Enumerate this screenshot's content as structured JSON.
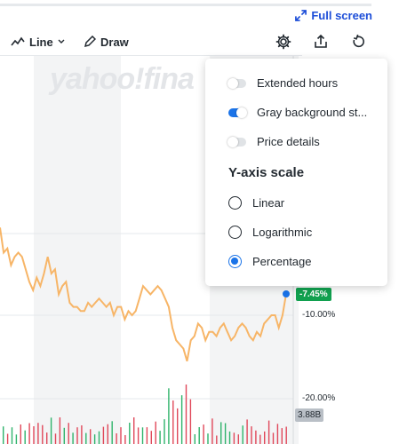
{
  "header": {
    "fullscreen_label": "Full screen",
    "fullscreen_icon": "expand-arrows-icon"
  },
  "toolbar": {
    "line_label": "Line",
    "line_icon": "line-chart-icon",
    "draw_label": "Draw",
    "draw_icon": "pencil-icon",
    "settings_icon": "gear-icon",
    "share_icon": "share-icon",
    "reset_icon": "reset-icon"
  },
  "watermark": "yahoo!fina",
  "chart": {
    "price_tag": "-7.45%",
    "y_labels": [
      "-10.00%",
      "-20.00%"
    ],
    "volume_tag": "3.88B",
    "colors": {
      "line": "#f7b567",
      "price_tag_bg": "#11a04f",
      "up_bar": "#2fb36b",
      "down_bar": "#e0485a",
      "shade": "#f3f4f5"
    }
  },
  "chart_data": {
    "type": "line",
    "y_unit": "percent",
    "y_ticks": [
      -10,
      -20
    ],
    "series": [
      {
        "values": [
          0.5,
          -2.5,
          -2,
          -4,
          -3,
          -2.5,
          -3,
          -4.5,
          -6,
          -7,
          -5.5,
          -6.5,
          -5,
          -3,
          -5,
          -4.5,
          -7.5,
          -6.5,
          -6,
          -8.5,
          -9,
          -9,
          -9.5,
          -9.5,
          -8.5,
          -9,
          -8.5,
          -8,
          -8.5,
          -9,
          -8.5,
          -10,
          -9,
          -9,
          -10.5,
          -9.5,
          -10,
          -9.5,
          -8,
          -6.5,
          -7,
          -7.5,
          -7,
          -6.5,
          -7,
          -8,
          -9,
          -11.5,
          -13,
          -13.5,
          -14,
          -15.5,
          -13,
          -12.5,
          -11,
          -11.5,
          -13,
          -12,
          -12,
          -12.5,
          -11.5,
          -11,
          -12,
          -13,
          -12.5,
          -11.5,
          -11,
          -11.5,
          -12.5,
          -13,
          -12,
          -12.5,
          -11,
          -10.5,
          -10,
          -10,
          -11.5,
          -10,
          -7.45
        ]
      }
    ],
    "volume": {
      "last_label": "3.88B"
    }
  },
  "menu": {
    "toggles": [
      {
        "label": "Extended hours",
        "on": false
      },
      {
        "label": "Gray background st...",
        "on": true
      },
      {
        "label": "Price details",
        "on": false
      }
    ],
    "yaxis_heading": "Y-axis scale",
    "radios": [
      {
        "label": "Linear",
        "selected": false
      },
      {
        "label": "Logarithmic",
        "selected": false
      },
      {
        "label": "Percentage",
        "selected": true
      }
    ]
  }
}
